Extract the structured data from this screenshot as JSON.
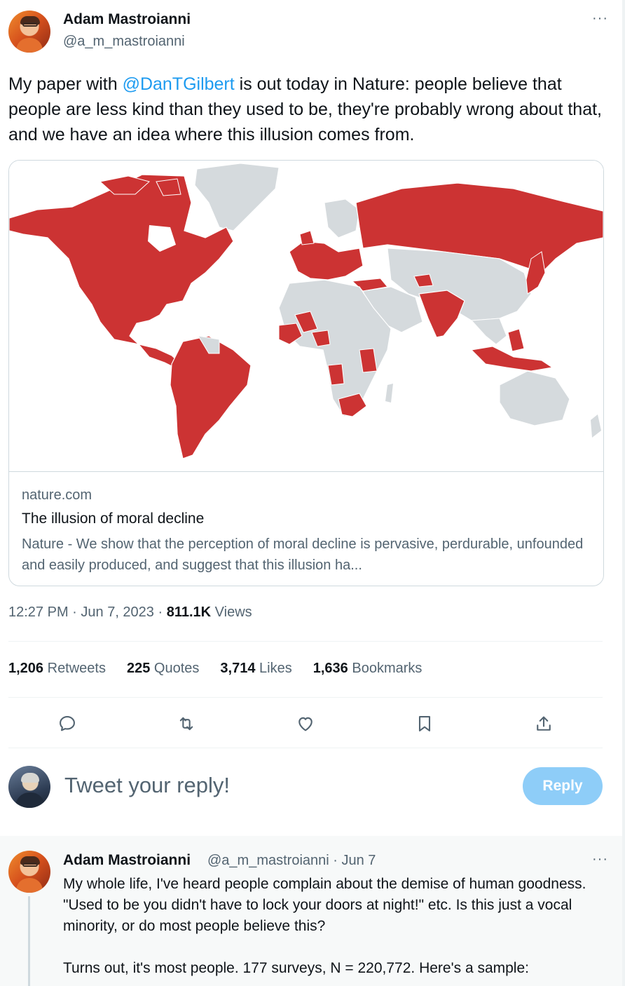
{
  "tweet": {
    "author_name": "Adam Mastroianni",
    "author_handle": "@a_m_mastroianni",
    "more_label": "···",
    "text_before": "My paper with ",
    "mention": "@DanTGilbert",
    "text_after": "  is out today in Nature: people believe that people are less kind than they used to be, they're probably wrong about that, and we have an idea where this illusion comes from.",
    "time": "12:27 PM",
    "separator": " · ",
    "date": "Jun 7, 2023",
    "views_count": "811.1K",
    "views_label": " Views"
  },
  "card": {
    "domain": "nature.com",
    "title": "The illusion of moral decline",
    "description": "Nature - We show that the perception of moral decline is pervasive, perdurable, unfounded and easily produced, and suggest that this illusion ha...",
    "image_icon": "world-map-image"
  },
  "stats": {
    "retweets_count": "1,206",
    "retweets_label": " Retweets",
    "quotes_count": "225",
    "quotes_label": " Quotes",
    "likes_count": "3,714",
    "likes_label": " Likes",
    "bookmarks_count": "1,636",
    "bookmarks_label": " Bookmarks"
  },
  "actions": [
    "reply-icon",
    "retweet-icon",
    "like-icon",
    "bookmark-icon",
    "share-icon"
  ],
  "reply_box": {
    "placeholder": "Tweet your reply!",
    "button_label": "Reply"
  },
  "thread": {
    "author_name": "Adam Mastroianni",
    "meta": "@a_m_mastroianni · Jun 7",
    "more_label": "···",
    "text": "My whole life, I've heard people complain about the demise of human goodness. \"Used to be you didn't have to lock your doors at night!\" etc. Is this just a vocal minority, or do most people believe this?",
    "text2": "Turns out, it's most people. 177 surveys, N = 220,772. Here's a sample:"
  },
  "colors": {
    "accent": "#1d9bf0",
    "reply_button_disabled": "#8ecdf8",
    "map_highlight": "#cc3333",
    "map_land": "#d5dadd",
    "secondary_text": "#536471"
  }
}
